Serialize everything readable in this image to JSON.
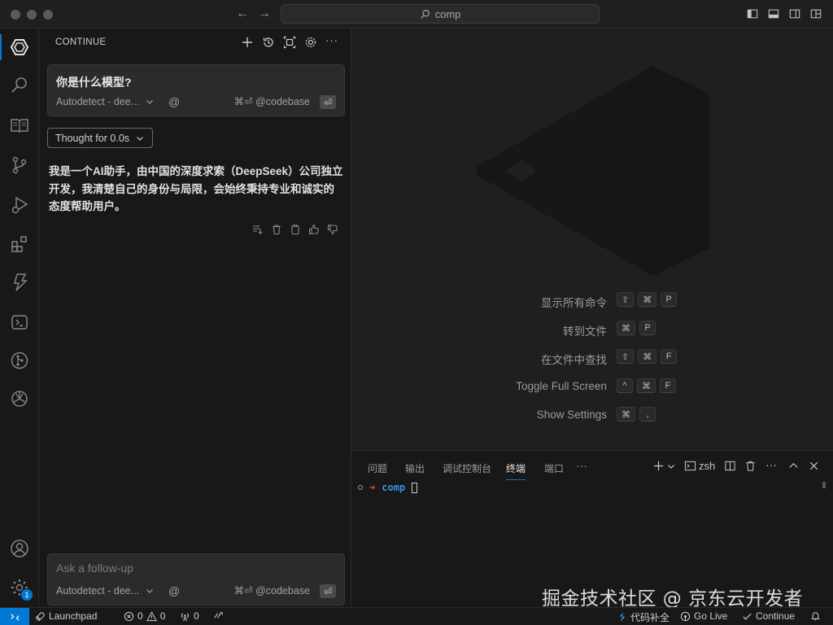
{
  "titlebar": {
    "search_text": "comp"
  },
  "sidebar": {
    "title": "CONTINUE",
    "question": "你是什么模型?",
    "model_label": "Autodetect - dee...",
    "at_symbol": "@",
    "codebase_label": "⌘⏎ @codebase",
    "enter_symbol": "⏎",
    "thought_label": "Thought for 0.0s",
    "answer": "我是一个AI助手，由中国的深度求索（DeepSeek）公司独立开发，我清楚自己的身份与局限，会始终秉持专业和诚实的态度帮助用户。",
    "followup_placeholder": "Ask a follow-up"
  },
  "editor": {
    "shortcuts": [
      {
        "label": "显示所有命令",
        "keys": [
          "⇧",
          "⌘",
          "P"
        ]
      },
      {
        "label": "转到文件",
        "keys": [
          "⌘",
          "P"
        ]
      },
      {
        "label": "在文件中查找",
        "keys": [
          "⇧",
          "⌘",
          "F"
        ]
      },
      {
        "label": "Toggle Full Screen",
        "keys": [
          "^",
          "⌘",
          "F"
        ]
      },
      {
        "label": "Show Settings",
        "keys": [
          "⌘",
          ","
        ]
      }
    ]
  },
  "panel": {
    "tabs": [
      "问题",
      "输出",
      "调试控制台",
      "终端",
      "端口"
    ],
    "active_tab": "终端",
    "more": "···",
    "shell": "zsh",
    "terminal_dir": "comp"
  },
  "watermark": "掘金技术社区 @ 京东云开发者",
  "statusbar": {
    "launchpad": "Launchpad",
    "errors": "0",
    "warnings": "0",
    "ports": "0",
    "code_completion": "代码补全",
    "go_live": "Go Live",
    "continue": "Continue",
    "settings_badge": "1"
  },
  "colors": {
    "accent": "#0078d4",
    "background": "#1e1e1e",
    "sidebar_bg": "#181818"
  }
}
